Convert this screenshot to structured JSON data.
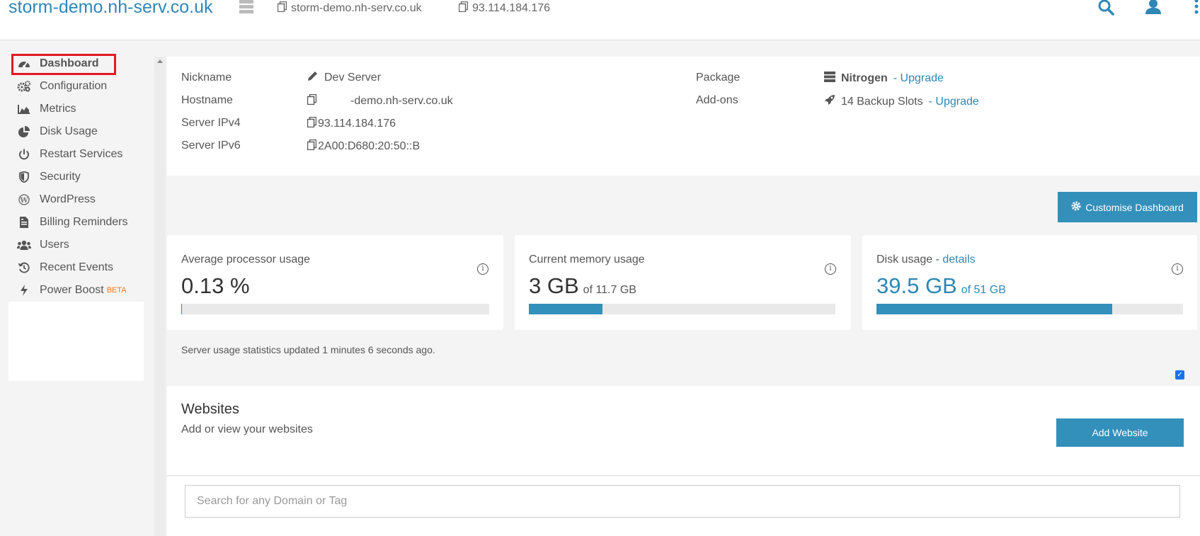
{
  "header": {
    "brand": "storm-demo.nh-serv.co.uk",
    "hostname": "storm-demo.nh-serv.co.uk",
    "ip": "93.114.184.176"
  },
  "sidebar": {
    "items": [
      {
        "label": "Dashboard",
        "icon": "gauge-icon"
      },
      {
        "label": "Configuration",
        "icon": "cogs-icon"
      },
      {
        "label": "Metrics",
        "icon": "area-chart-icon"
      },
      {
        "label": "Disk Usage",
        "icon": "pie-chart-icon"
      },
      {
        "label": "Restart Services",
        "icon": "power-icon"
      },
      {
        "label": "Security",
        "icon": "shield-icon"
      },
      {
        "label": "WordPress",
        "icon": "wordpress-icon"
      },
      {
        "label": "Billing Reminders",
        "icon": "invoice-icon"
      },
      {
        "label": "Users",
        "icon": "users-icon"
      },
      {
        "label": "Recent Events",
        "icon": "history-icon"
      },
      {
        "label": "Power Boost",
        "icon": "bolt-icon"
      }
    ],
    "beta": "BETA"
  },
  "server": {
    "nickname_label": "Nickname",
    "nickname": "Dev Server",
    "hostname_label": "Hostname",
    "hostname": "-demo.nh-serv.co.uk",
    "ipv4_label": "Server IPv4",
    "ipv4": "93.114.184.176",
    "ipv6_label": "Server IPv6",
    "ipv6": "2A00:D680:20:50::B",
    "package_label": "Package",
    "package": "Nitrogen",
    "package_upgrade": "- Upgrade",
    "addons_label": "Add-ons",
    "addons": "14 Backup Slots",
    "addons_upgrade": "- Upgrade"
  },
  "customise_button": "Customise Dashboard",
  "stats": {
    "cpu": {
      "title": "Average processor usage",
      "value": "0.13 %",
      "percent": 0.13
    },
    "memory": {
      "title": "Current memory usage",
      "value": "3 GB",
      "of": "of 11.7 GB",
      "percent": 24
    },
    "disk": {
      "title": "Disk usage",
      "title_sep": " - ",
      "details": "details",
      "value": "39.5 GB",
      "of": "of 51 GB",
      "percent": 77
    },
    "updated": "Server usage statistics updated 1 minutes 6 seconds ago."
  },
  "websites": {
    "title": "Websites",
    "subtitle": "Add or view your websites",
    "add_button": "Add Website",
    "search_placeholder": "Search for any Domain or Tag"
  },
  "colors": {
    "accent": "#3390ba",
    "brand": "#2e87b6",
    "highlight": "#e01b24",
    "beta": "#f07a1c"
  }
}
